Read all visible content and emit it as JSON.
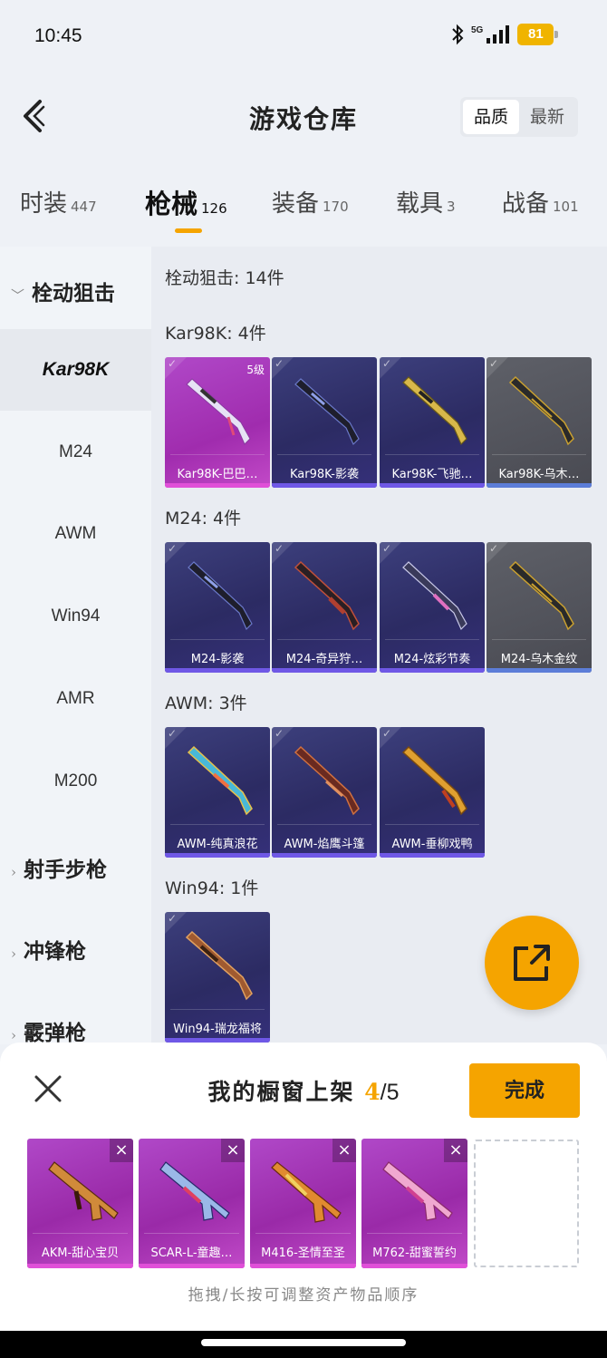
{
  "status_bar": {
    "time": "10:45",
    "battery": "81",
    "network": "5G"
  },
  "header": {
    "title": "游戏仓库",
    "sort_options": [
      "品质",
      "最新"
    ]
  },
  "tabs": [
    {
      "label": "时装",
      "count": "447"
    },
    {
      "label": "枪械",
      "count": "126"
    },
    {
      "label": "装备",
      "count": "170"
    },
    {
      "label": "载具",
      "count": "3"
    },
    {
      "label": "战备",
      "count": "101"
    }
  ],
  "sidebar": {
    "groups": [
      "栓动狙击",
      "射手步枪",
      "冲锋枪",
      "霰弹枪"
    ],
    "items": [
      "Kar98K",
      "M24",
      "AWM",
      "Win94",
      "AMR",
      "M200"
    ]
  },
  "content": {
    "category_header": "栓动狙击: 14件",
    "sections": [
      {
        "label": "Kar98K: 4件",
        "cards": [
          {
            "name": "Kar98K-巴巴…",
            "level": "5级"
          },
          {
            "name": "Kar98K-影袭"
          },
          {
            "name": "Kar98K-飞驰…"
          },
          {
            "name": "Kar98K-乌木…"
          }
        ]
      },
      {
        "label": "M24: 4件",
        "cards": [
          {
            "name": "M24-影袭"
          },
          {
            "name": "M24-奇异狩…"
          },
          {
            "name": "M24-炫彩节奏"
          },
          {
            "name": "M24-乌木金纹"
          }
        ]
      },
      {
        "label": "AWM: 3件",
        "cards": [
          {
            "name": "AWM-纯真浪花"
          },
          {
            "name": "AWM-焰鹰斗篷"
          },
          {
            "name": "AWM-垂柳戏鸭"
          }
        ]
      },
      {
        "label": "Win94: 1件",
        "cards": [
          {
            "name": "Win94-瑞龙福将"
          }
        ]
      }
    ]
  },
  "shelf": {
    "title": "我的橱窗上架",
    "count": "4",
    "total": "/5",
    "done_label": "完成",
    "items": [
      "AKM-甜心宝贝",
      "SCAR-L-童趣…",
      "M416-圣情至圣",
      "M762-甜蜜誓约"
    ],
    "hint": "拖拽/长按可调整资产物品顺序"
  },
  "colors": {
    "accent": "#f5a400",
    "epic": "#a02cae",
    "legendary": "#2c2b63"
  }
}
